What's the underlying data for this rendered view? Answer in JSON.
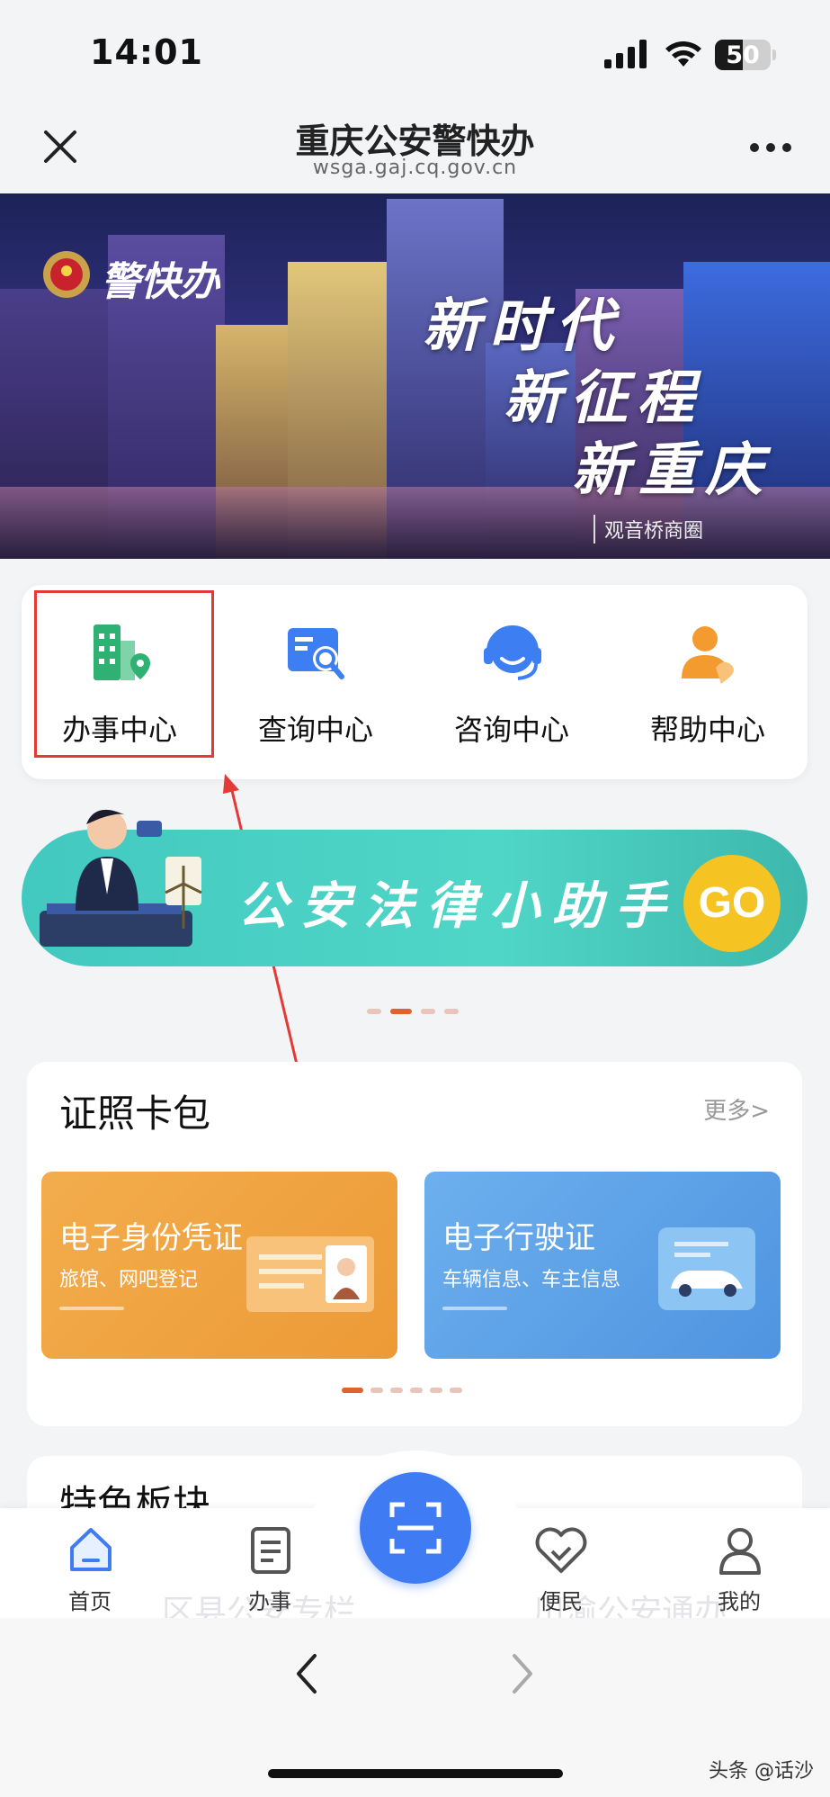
{
  "status_bar": {
    "time": "14:01",
    "battery": "50"
  },
  "nav": {
    "title": "重庆公安警快办",
    "url": "wsga.gaj.cq.gov.cn"
  },
  "banner": {
    "logo_text": "警快办",
    "slogan": [
      "新时代",
      "新征程",
      "新重庆"
    ],
    "caption": "观音桥商圈"
  },
  "services": [
    {
      "label": "办事中心",
      "icon": "office-building-icon",
      "color": "#2fb173"
    },
    {
      "label": "查询中心",
      "icon": "search-document-icon",
      "color": "#3d7ef2"
    },
    {
      "label": "咨询中心",
      "icon": "headset-icon",
      "color": "#3d7ef2"
    },
    {
      "label": "帮助中心",
      "icon": "helping-hand-icon",
      "color": "#f39b2e"
    }
  ],
  "legal_banner": {
    "text": "公安法律小助手",
    "go": "GO"
  },
  "wallet": {
    "title": "证照卡包",
    "more": "更多>",
    "cards": [
      {
        "title": "电子身份凭证",
        "subtitle": "旅馆、网吧登记",
        "color": "#f0a23e"
      },
      {
        "title": "电子行驶证",
        "subtitle": "车辆信息、车主信息",
        "color": "#5fa4e8"
      }
    ]
  },
  "feature": {
    "title": "特色板块",
    "items": [
      "区县公安专栏",
      "川渝公安通办"
    ]
  },
  "tabbar": [
    {
      "label": "首页",
      "active": true
    },
    {
      "label": "办事",
      "active": false
    },
    {
      "label": "便民",
      "active": false
    },
    {
      "label": "我的",
      "active": false
    }
  ],
  "watermark": "头条 @话沙",
  "colors": {
    "accent": "#3f7cf3",
    "highlight": "#e53935"
  }
}
